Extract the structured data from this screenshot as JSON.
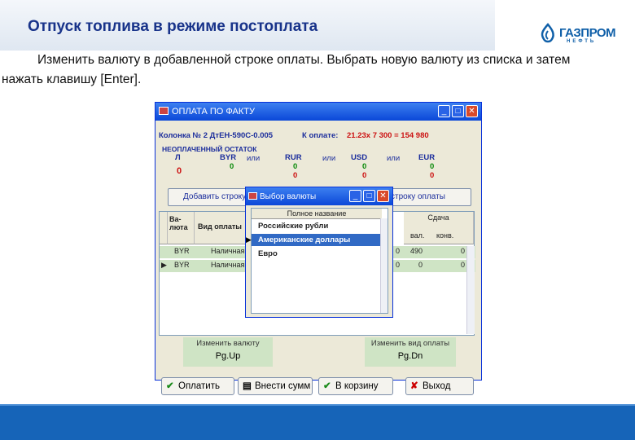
{
  "slide": {
    "title": "Отпуск топлива в режиме постоплата",
    "logo": "ГАЗПРОМ",
    "logo_sub": "НЕФТЬ",
    "instruction_line1": "Изменить валюту в добавленной строке оплаты. Выбрать новую валюту из списка и затем",
    "instruction_line2": "нажать клавишу [Enter]."
  },
  "window": {
    "title": "ОПЛАТА ПО ФАКТУ",
    "line1_left": "Колонка № 2 ДтЕН-590С-0.005",
    "line1_due_label": "К оплате:",
    "line1_due_value": "21.23х  7 300 =   154 980",
    "remaining_label": "НЕОПЛАЧЕННЫЙ ОСТАТОК",
    "currencies": [
      {
        "code": "Л",
        "v1": "0",
        "v2": ""
      },
      {
        "code": "BYR",
        "v1": "0",
        "v2": ""
      },
      {
        "code": "RUR",
        "v1": "0",
        "v2": "0"
      },
      {
        "code": "USD",
        "v1": "0",
        "v2": "0"
      },
      {
        "code": "EUR",
        "v1": "0",
        "v2": "0"
      }
    ],
    "or_label": "или",
    "add_row_button": "Добавить строку",
    "add_row_button2": "строку оплаты",
    "grid_headers": {
      "currency": "Ва-\nлюта",
      "payment_type": "Вид оплаты",
      "change": "Сдача",
      "val": "вал.",
      "conv": "конв."
    },
    "rows": [
      {
        "currency": "BYR",
        "type": "Наличная",
        "n1": "0",
        "n2": "490",
        "n3": "0"
      },
      {
        "currency": "BYR",
        "type": "Наличная",
        "n1": "0",
        "n2": "0",
        "n3": "0"
      }
    ],
    "hint_left": {
      "label": "Изменить валюту",
      "key": "Pg.Up"
    },
    "hint_right": {
      "label": "Изменить вид оплаты",
      "key": "Pg.Dn"
    },
    "buttons": {
      "pay": "Оплатить",
      "enter_sum": "Внести сумм",
      "basket": "В корзину",
      "exit": "Выход"
    }
  },
  "dialog": {
    "title": "Выбор валюты",
    "header": "Полное название",
    "options": [
      "Российские рубли",
      "Американские доллары",
      "Евро"
    ],
    "selected": 1
  }
}
